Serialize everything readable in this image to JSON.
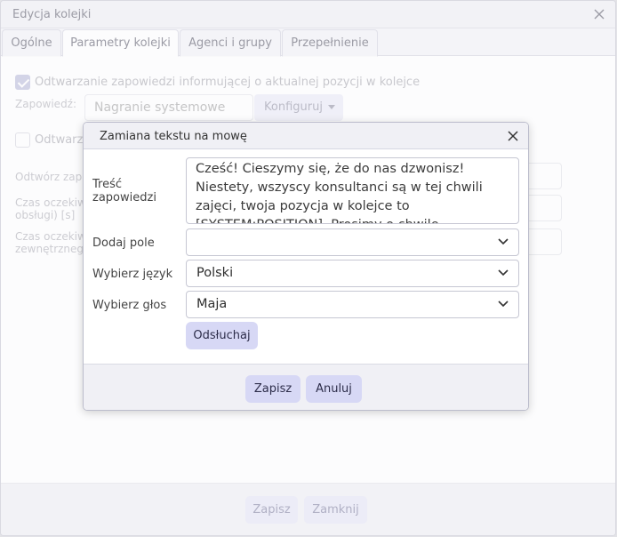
{
  "window": {
    "title": "Edycja kolejki",
    "tabs": [
      {
        "label": "Ogólne"
      },
      {
        "label": "Parametry kolejki"
      },
      {
        "label": "Agenci i grupy"
      },
      {
        "label": "Przepełnienie"
      }
    ],
    "active_tab": "Parametry kolejki"
  },
  "content": {
    "announce_checkbox_label": "Odtwarzanie zapowiedzi informującej o aktualnej pozycji w kolejce",
    "announce_checked": true,
    "announce_label": "Zapowiedź:",
    "announce_value": "Nagranie systemowe",
    "configure_label": "Konfiguruj",
    "second_checkbox_label": "Odtwarza",
    "second_checked": false,
    "row1_label": "Odtwórz zap",
    "row2_label_line1": "Czas oczekiw",
    "row2_label_line2": "obsługi) [s]",
    "row3_label_line1": "Czas oczekiw",
    "row3_label_line2": "zewnętrzneg"
  },
  "footer": {
    "save_label": "Zapisz",
    "close_label": "Zamknij"
  },
  "modal": {
    "title": "Zamiana tekstu na mowę",
    "text_label_line1": "Treść",
    "text_label_line2": "zapowiedzi",
    "text_value": "Cześć! Cieszymy się, że do nas dzwonisz! Niestety, wszyscy konsultanci są w tej chwili zajęci, twoja pozycja w kolejce to [SYSTEM:POSITION]. Prosimy o chwilę cierpliwości! Dziękujemy!",
    "add_field_label": "Dodaj pole",
    "add_field_value": "",
    "language_label": "Wybierz język",
    "language_value": "Polski",
    "voice_label": "Wybierz głos",
    "voice_value": "Maja",
    "listen_label": "Odsłuchaj",
    "save_label": "Zapisz",
    "cancel_label": "Anuluj"
  },
  "colors": {
    "accent": "#d7d8f5",
    "checkbox_checked": "#8e90c2"
  }
}
